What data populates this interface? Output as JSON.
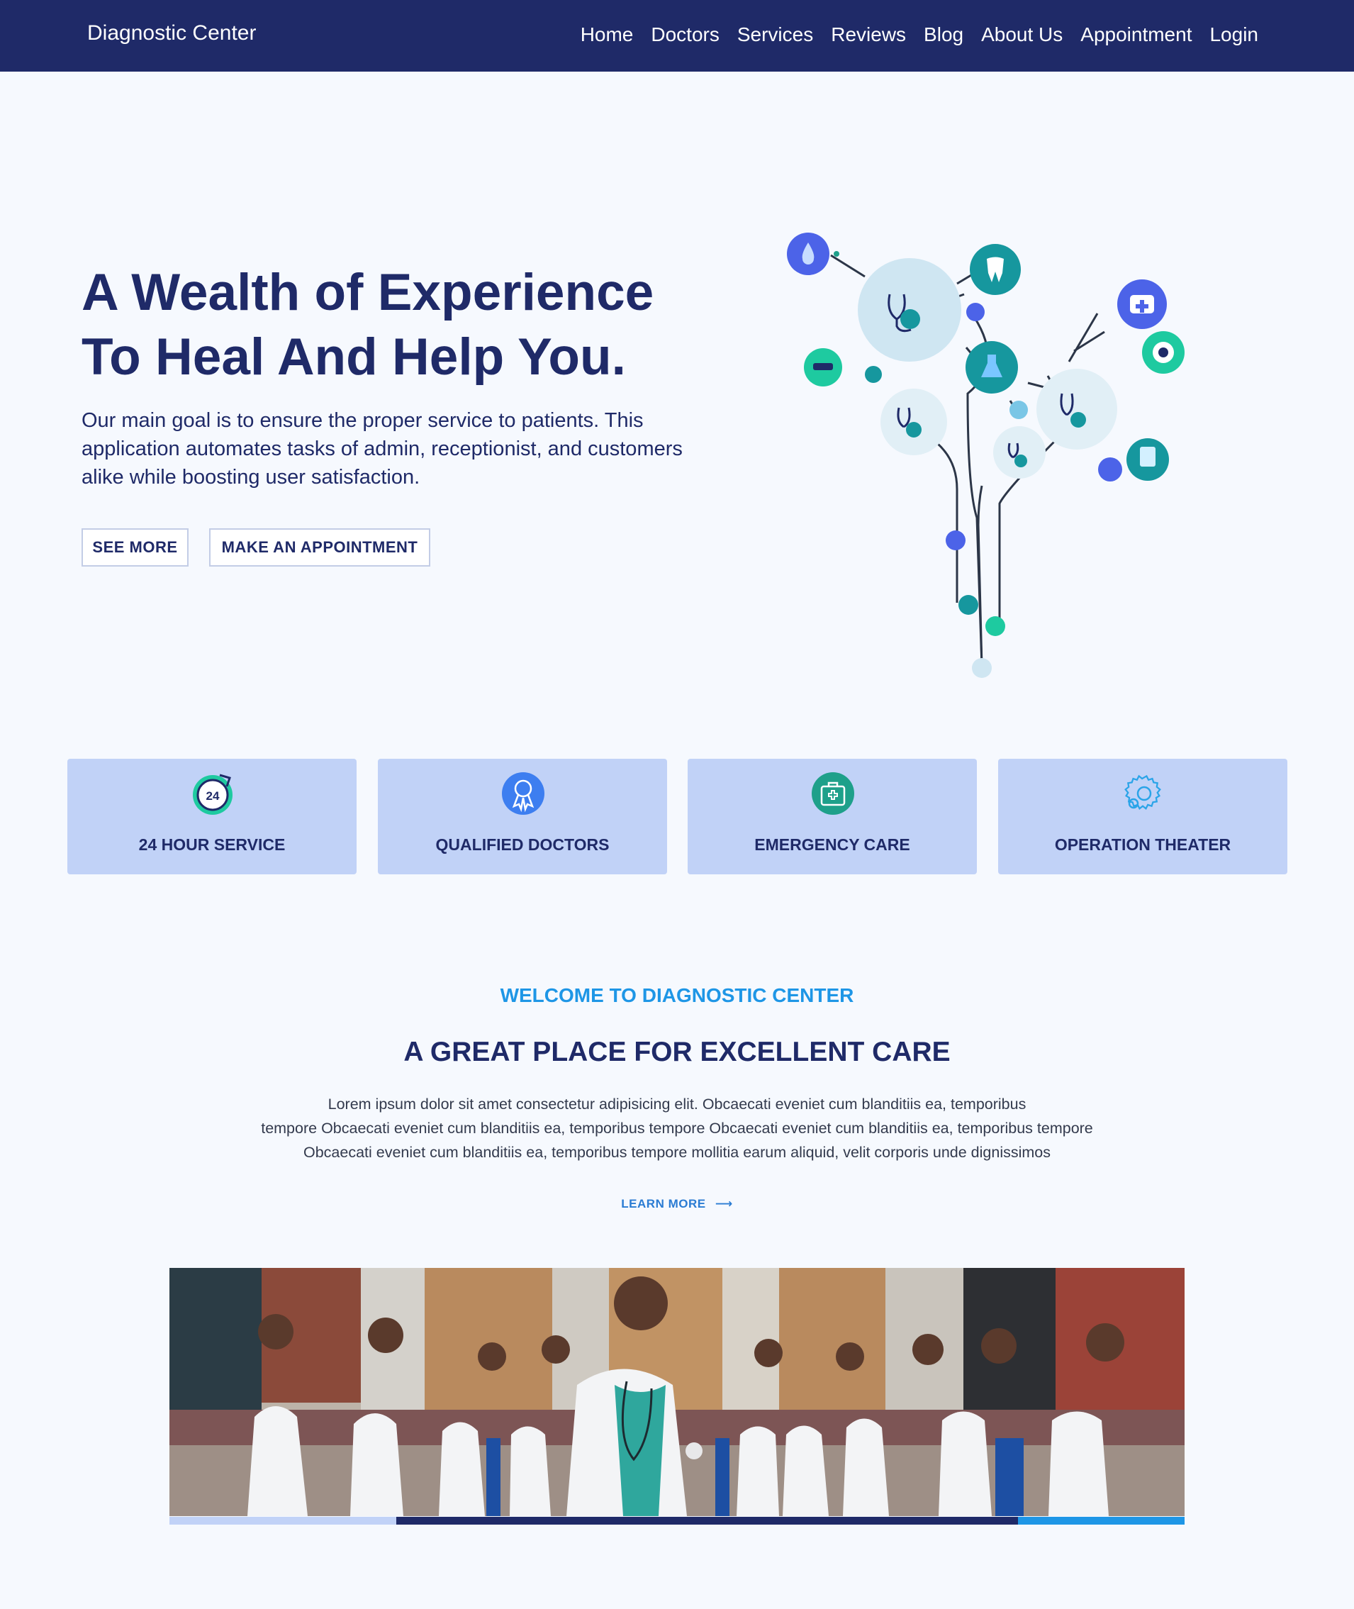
{
  "nav": {
    "brand": "Diagnostic Center",
    "links": [
      "Home",
      "Doctors",
      "Services",
      "Reviews",
      "Blog",
      "About Us",
      "Appointment",
      "Login"
    ]
  },
  "hero": {
    "title_line1": "A Wealth of Experience",
    "title_line2": "To Heal And Help You.",
    "description": "Our main goal is to ensure the proper service to patients. This application automates tasks of admin, receptionist, and customers alike while boosting user satisfaction.",
    "see_more_label": "SEE MORE",
    "appointment_label": "MAKE AN APPOINTMENT",
    "illustration_icons": [
      "water-drop-icon",
      "tooth-icon",
      "first-aid-kit-icon",
      "eye-icon",
      "glasses-icon",
      "flask-icon",
      "stethoscope-globe-icon",
      "tablet-icon"
    ]
  },
  "features": [
    {
      "label": "24 HOUR SERVICE",
      "icon": "clock-24-icon"
    },
    {
      "label": "QUALIFIED DOCTORS",
      "icon": "award-badge-icon"
    },
    {
      "label": "EMERGENCY CARE",
      "icon": "medical-bag-icon"
    },
    {
      "label": "OPERATION THEATER",
      "icon": "gear-icon"
    }
  ],
  "welcome": {
    "subtitle": "WELCOME TO DIAGNOSTIC CENTER",
    "title": "A GREAT PLACE FOR EXCELLENT CARE",
    "text_line1": "Lorem ipsum dolor sit amet consectetur adipisicing elit. Obcaecati eveniet cum blanditiis ea, temporibus",
    "text_line2": "tempore Obcaecati eveniet cum blanditiis ea, temporibus tempore Obcaecati eveniet cum blanditiis ea, temporibus tempore",
    "text_line3": "Obcaecati eveniet cum blanditiis ea, temporibus tempore mollitia earum aliquid, velit corporis unde dignissimos",
    "learn_more_label": "LEARN MORE",
    "learn_more_arrow": "⟶"
  },
  "colors": {
    "primary": "#1f2a68",
    "accent": "#1e96e6",
    "card_bg": "#c1d2f7",
    "page_bg": "#f6f9fe"
  }
}
